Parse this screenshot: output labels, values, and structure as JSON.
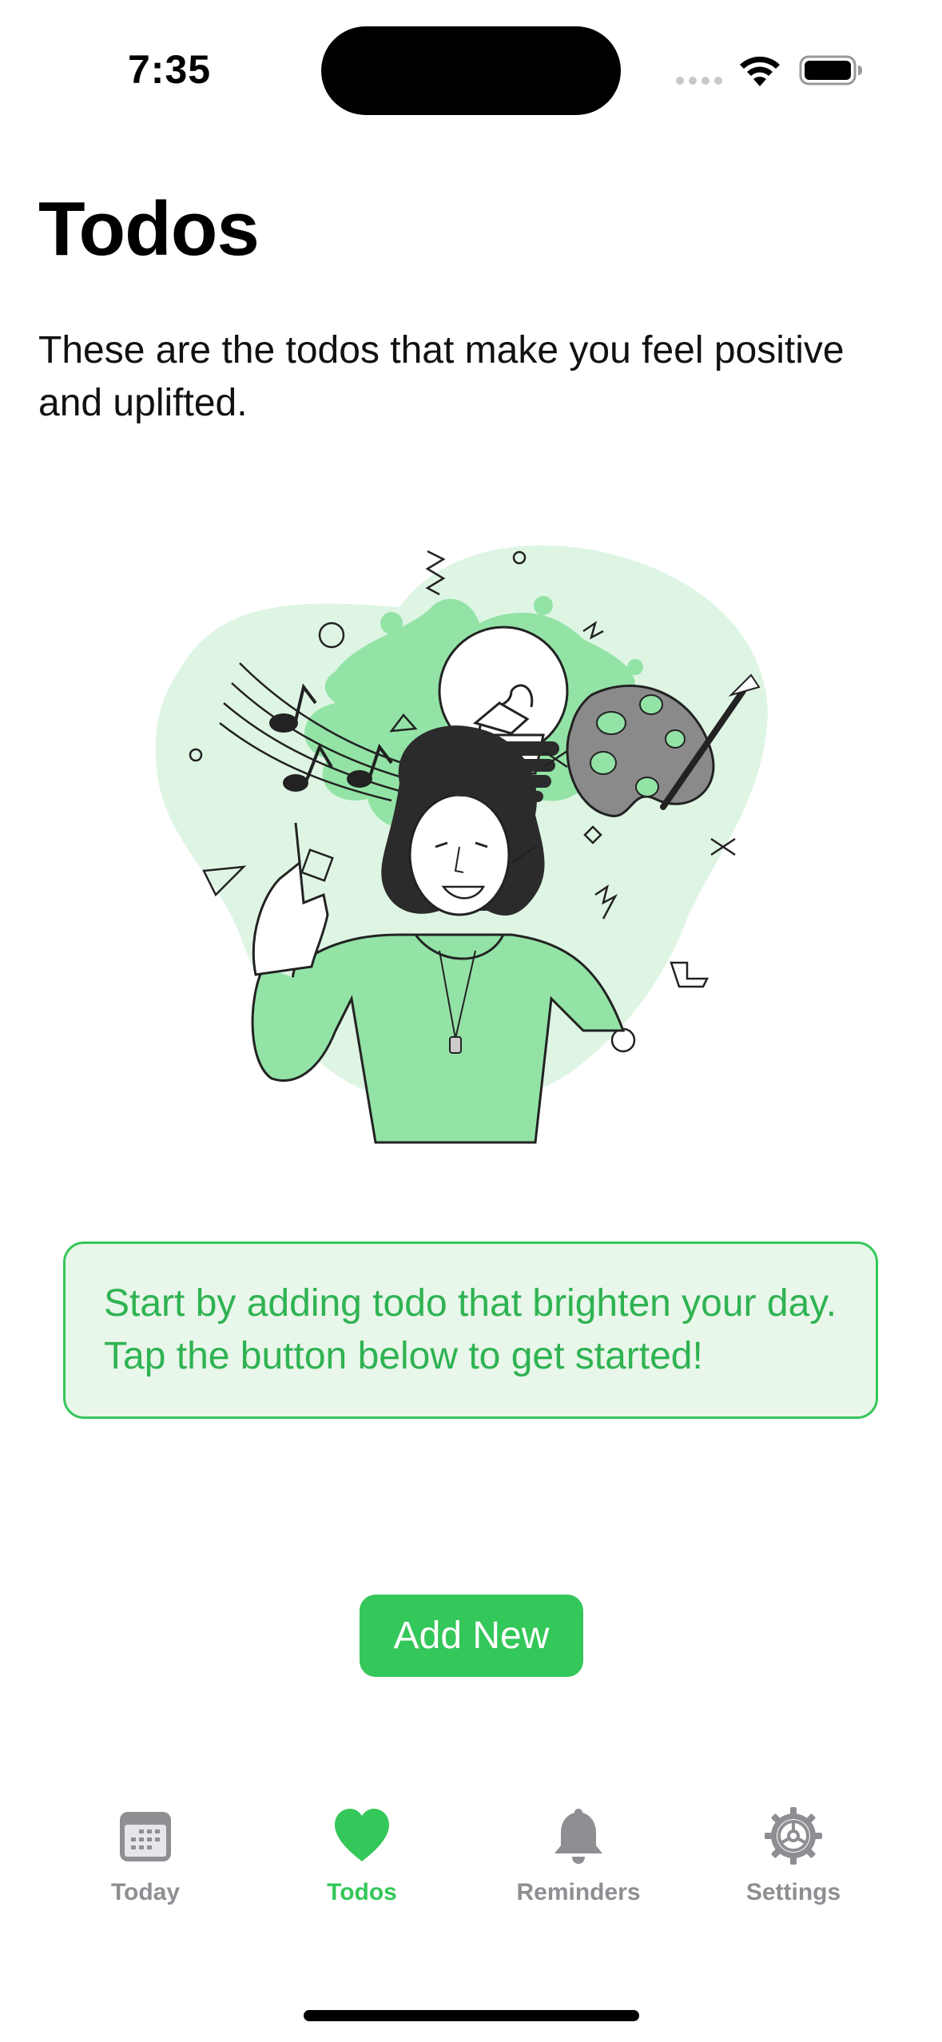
{
  "status_bar": {
    "time": "7:35"
  },
  "header": {
    "title": "Todos",
    "subtitle": "These are the todos that make you feel positive and uplifted."
  },
  "empty_state": {
    "illustration_icon": "woman-idea-lightbulb-illustration",
    "hint": "Start by adding todo that brighten your day. Tap the button below to get started!"
  },
  "actions": {
    "add_label": "Add New"
  },
  "tab_bar": {
    "items": [
      {
        "label": "Today",
        "icon": "calendar-icon",
        "active": false
      },
      {
        "label": "Todos",
        "icon": "heart-icon",
        "active": true
      },
      {
        "label": "Reminders",
        "icon": "bell-icon",
        "active": false
      },
      {
        "label": "Settings",
        "icon": "gear-icon",
        "active": false
      }
    ]
  },
  "colors": {
    "accent": "#34C759",
    "hint_background": "#E9F6EA",
    "inactive_tab": "#8E8E93",
    "illustration_light": "#DFF5E4",
    "illustration_mid": "#93E3A6"
  }
}
